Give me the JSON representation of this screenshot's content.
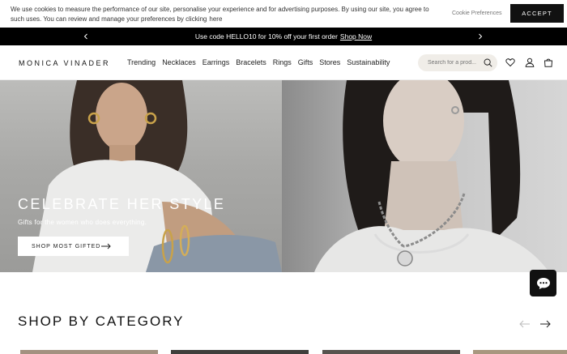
{
  "cookie": {
    "text": "We use cookies to measure the performance of our site, personalise your experience and for advertising purposes. By using our site, you agree to such uses. You can review and manage your preferences by clicking",
    "link": "here",
    "preferences": "Cookie Preferences",
    "accept": "ACCEPT"
  },
  "promo": {
    "text": "Use code HELLO10 for 10% off your first order",
    "link": "Shop Now"
  },
  "header": {
    "logo": "MONICA VINADER",
    "nav": [
      "Trending",
      "Necklaces",
      "Earrings",
      "Bracelets",
      "Rings",
      "Gifts",
      "Stores",
      "Sustainability"
    ],
    "search_placeholder": "Search for a prod..."
  },
  "hero": {
    "title": "CELEBRATE HER STYLE",
    "subtitle": "Gifts for the women who does everything.",
    "button": "SHOP MOST GIFTED"
  },
  "category": {
    "title": "SHOP BY CATEGORY"
  },
  "icons": {
    "search": "search-icon",
    "wishlist": "heart-icon",
    "account": "user-icon",
    "bag": "shopping-bag-icon",
    "chat": "chat-bubble-icon"
  },
  "colors": {
    "promo_bg": "#000000",
    "accept_bg": "#111111",
    "search_bg": "#f0ede8"
  }
}
